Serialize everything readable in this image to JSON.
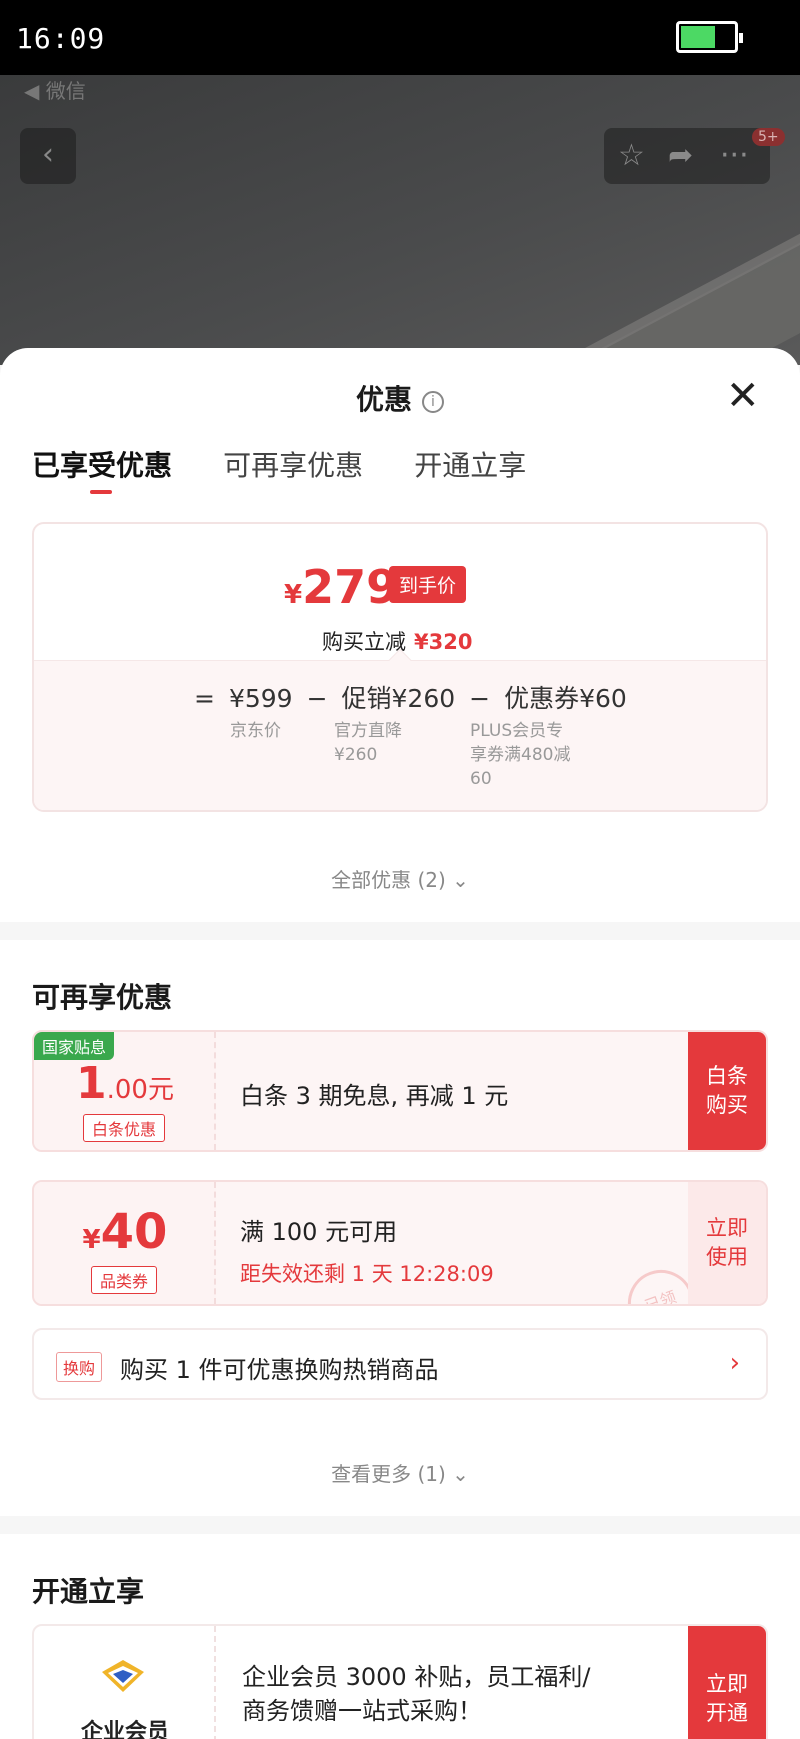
{
  "status_bar": {
    "time": "16:09"
  },
  "background": {
    "back_label": "◀ 微信",
    "badge": "5+"
  },
  "sheet": {
    "title": "优惠",
    "tabs": [
      "已享受优惠",
      "可再享优惠",
      "开通立享"
    ],
    "price_card": {
      "currency": "¥",
      "final_price": "279",
      "final_tag": "到手价",
      "reduce_label": "购买立减",
      "reduce_value": "¥320",
      "formula": [
        "=",
        "¥599",
        "−",
        "促销¥260",
        "−",
        "优惠券¥60"
      ],
      "captions": {
        "jd_price": "京东价",
        "promo_1": "官方直降",
        "promo_2": "¥260",
        "coupon_1": "PLUS会员专",
        "coupon_2": "享券满480减",
        "coupon_3": "60"
      }
    },
    "all_offers": "全部优惠 (2) ⌄",
    "more_section": {
      "title": "可再享优惠",
      "baitiao": {
        "corner_tag": "国家贴息",
        "amount_big": "1",
        "amount_rest": ".00元",
        "type_tag": "白条优惠",
        "desc": "白条 3 期免息, 再减 1 元",
        "cta_1": "白条",
        "cta_2": "购买"
      },
      "coupon": {
        "currency": "¥",
        "amount": "40",
        "type_tag": "品类券",
        "desc": "满 100 元可用",
        "expire": "距失效还剩 1 天 12:28:09",
        "stamp": "已领",
        "cta_1": "立即",
        "cta_2": "使用"
      },
      "swap": {
        "tag": "换购",
        "text": "购买 1 件可优惠换购热销商品",
        "chevron": "›"
      },
      "see_more": "查看更多 (1) ⌄"
    },
    "open_section": {
      "title": "开通立享",
      "member": {
        "label": "企业会员",
        "line_1": "企业会员 3000 补贴，员工福利/",
        "line_2": "商务馈赠一站式采购！",
        "cta_1": "立即",
        "cta_2": "开通"
      }
    }
  },
  "colors": {
    "accent": "#e4393c",
    "gov_tag": "#3aa84d"
  }
}
